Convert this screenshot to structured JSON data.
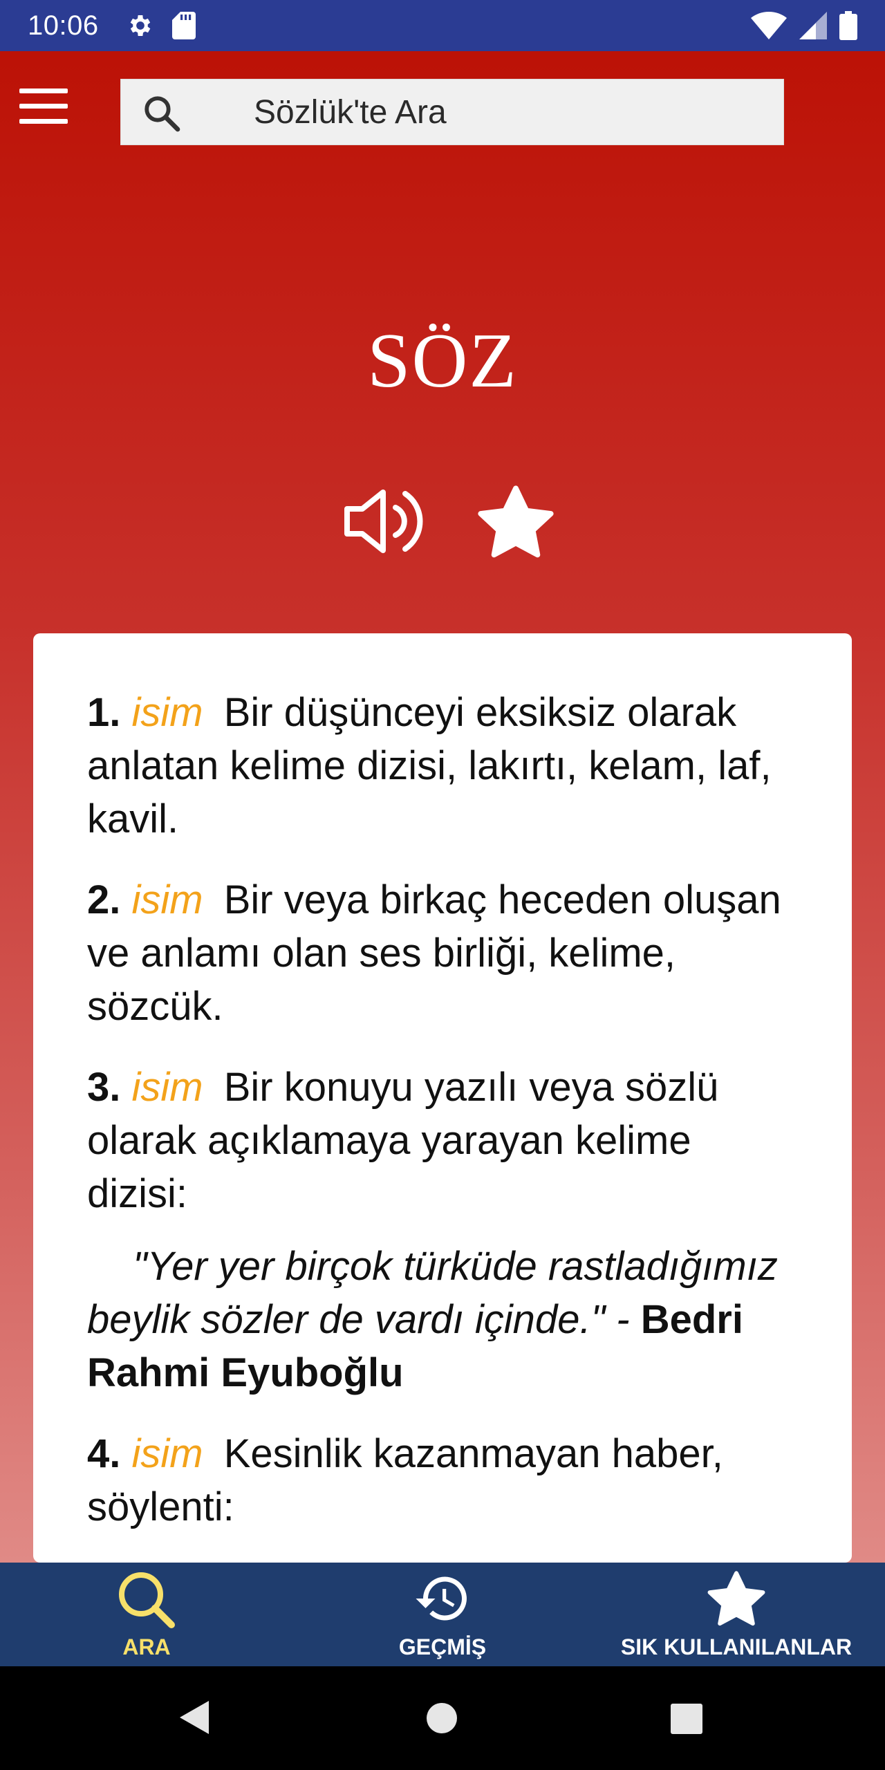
{
  "status_bar": {
    "time": "10:06",
    "left_icons": [
      "gear-icon",
      "sd-card-icon"
    ],
    "right_icons": [
      "wifi-icon",
      "signal-icon",
      "battery-icon"
    ]
  },
  "header": {
    "menu_icon": "menu-icon",
    "search_placeholder": "Sözlük'te Ara",
    "search_value": ""
  },
  "entry": {
    "word": "SÖZ",
    "actions": [
      "speaker-icon",
      "star-icon"
    ],
    "definitions": [
      {
        "number": "1.",
        "pos": "isim",
        "text": "Bir düşünceyi eksiksiz olarak anlatan kelime dizisi, lakırtı, kelam, laf, kavil."
      },
      {
        "number": "2.",
        "pos": "isim",
        "text": "Bir veya birkaç heceden oluşan ve anlamı olan ses birliği, kelime, sözcük."
      },
      {
        "number": "3.",
        "pos": "isim",
        "text": "Bir konuyu yazılı veya sözlü olarak açıklamaya yarayan kelime dizisi:",
        "example": "\"Yer yer birçok türküde rastladığımız beylik sözler de vardı içinde.\"",
        "example_separator": " - ",
        "example_author": "Bedri Rahmi Eyuboğlu"
      },
      {
        "number": "4.",
        "pos": "isim",
        "text": "Kesinlik kazanmayan haber, söylenti:"
      }
    ]
  },
  "bottom_nav": {
    "items": [
      {
        "label": "ARA",
        "icon": "search-icon",
        "active": true
      },
      {
        "label": "GEÇMİŞ",
        "icon": "history-icon",
        "active": false
      },
      {
        "label": "SIK KULLANILANLAR",
        "icon": "star-icon",
        "active": false
      }
    ]
  },
  "colors": {
    "status_bar": "#2b3c93",
    "header_red": "#bb0f03",
    "pos_orange": "#f3a21a",
    "bottom_nav": "#1f3d6e",
    "nav_active": "#f7e06a"
  }
}
